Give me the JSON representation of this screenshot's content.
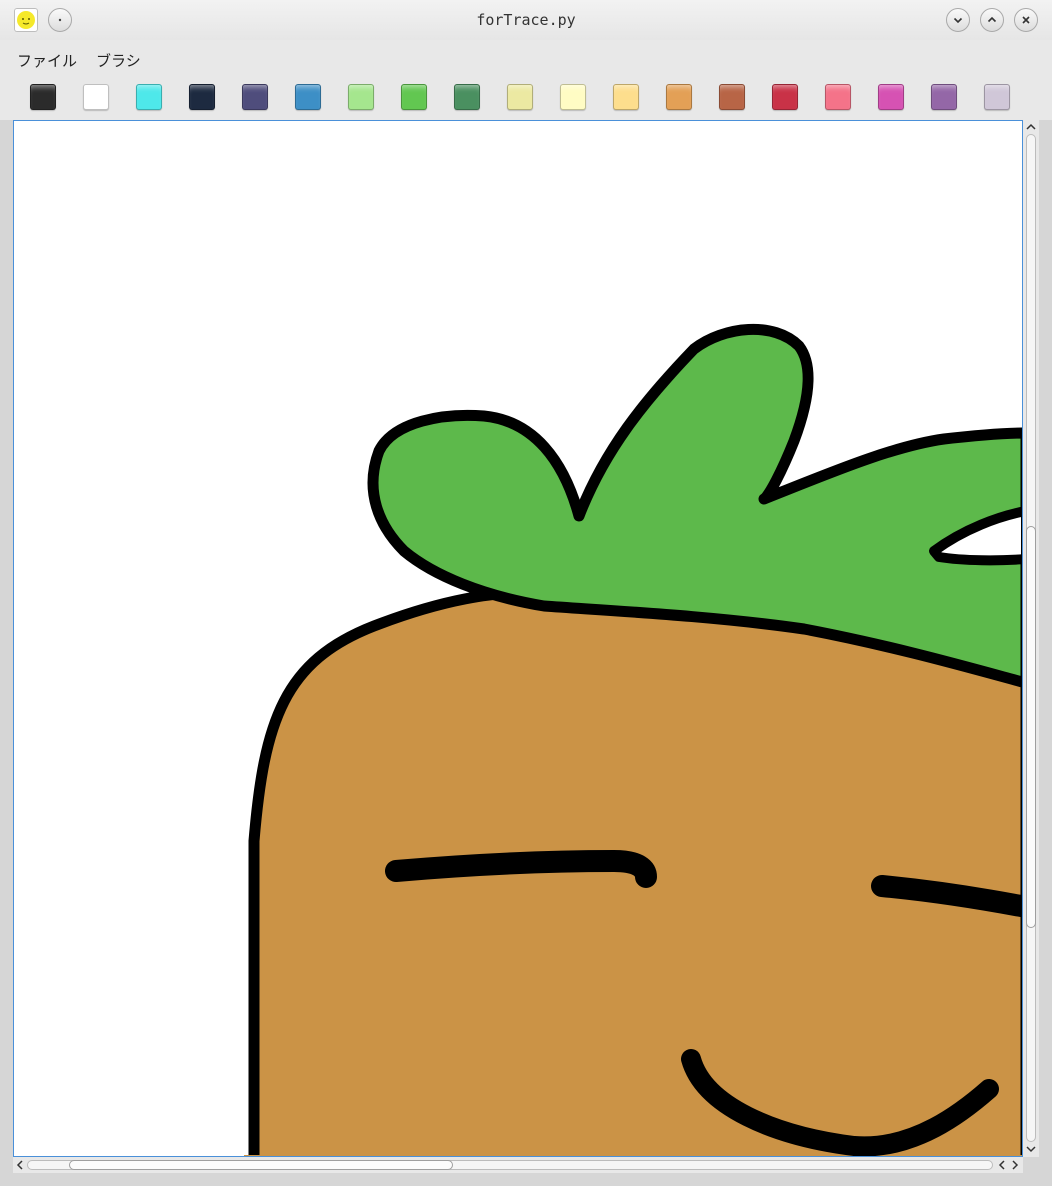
{
  "window": {
    "title": "forTrace.py",
    "buttons": [
      "minimize",
      "maximize",
      "close"
    ]
  },
  "menu": {
    "items": [
      {
        "label": "ファイル"
      },
      {
        "label": "ブラシ"
      }
    ]
  },
  "palette": {
    "colors": [
      "#2b2b2b",
      "#ffffff",
      "#4ee8ea",
      "#1d2a40",
      "#4f4d7c",
      "#3d8fc6",
      "#a5e68e",
      "#62c751",
      "#4a9060",
      "#ece9a2",
      "#fffcc4",
      "#fdde8d",
      "#e3a056",
      "#b86546",
      "#c93247",
      "#f47389",
      "#d652b3",
      "#9467a7",
      "#d0c7d8"
    ]
  },
  "drawing": {
    "fill_leaves": "#5db94b",
    "fill_body": "#cb9346",
    "stroke": "#000000"
  }
}
